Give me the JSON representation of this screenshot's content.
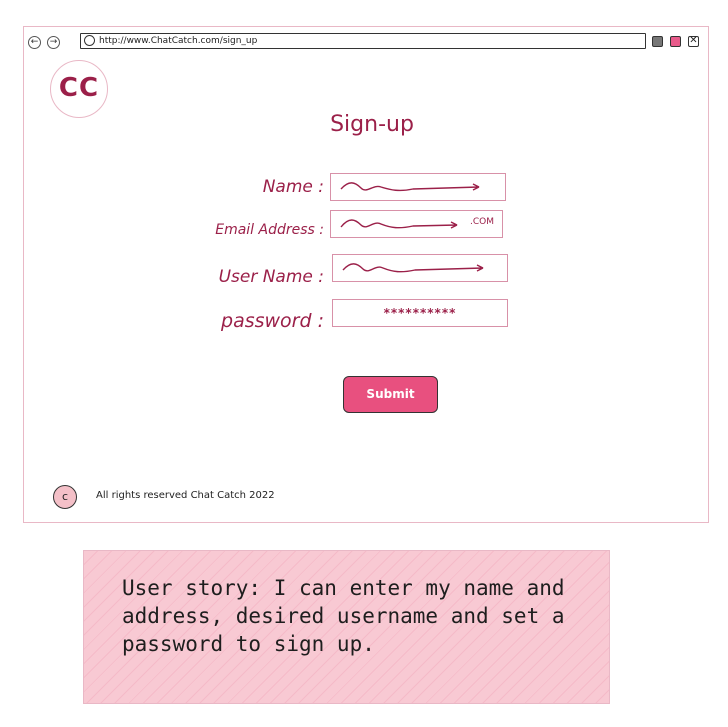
{
  "browser": {
    "url": "http://www.ChatCatch.com/sign_up",
    "nav": {
      "back": "←",
      "forward": "→"
    },
    "window_buttons": {
      "close_glyph": "✕"
    }
  },
  "logo": {
    "text": "CC"
  },
  "page": {
    "title": "Sign-up"
  },
  "form": {
    "name": {
      "label": "Name :"
    },
    "email": {
      "label": "Email Address :",
      "suffix": ".COM"
    },
    "username": {
      "label": "User Name :"
    },
    "password": {
      "label": "password :",
      "mask": "**********"
    },
    "submit_label": "Submit"
  },
  "footer": {
    "icon_text": "c",
    "text": "All rights reserved Chat Catch 2022"
  },
  "user_story": {
    "text": "User story: I can enter my name and address, desired username and set a password to sign up."
  },
  "colors": {
    "accent": "#9b2049",
    "button": "#e8507f",
    "border": "#e9b8c6",
    "note_bg": "#f8c9d3"
  }
}
